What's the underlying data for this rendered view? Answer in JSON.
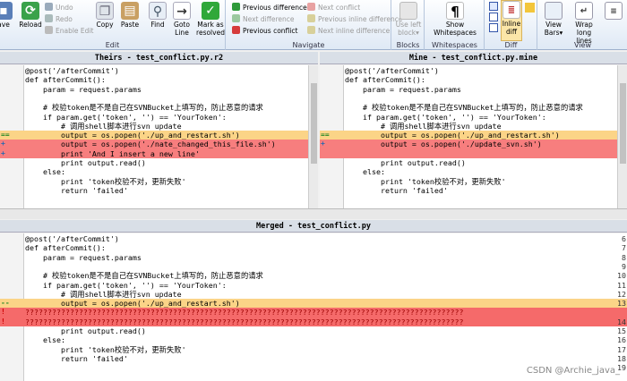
{
  "ribbon": {
    "edit": {
      "caption": "Edit",
      "save": "ave",
      "reload": "Reload",
      "undo": "Undo",
      "redo": "Redo",
      "enable_edit": "Enable Edit",
      "copy": "Copy",
      "paste": "Paste",
      "find": "Find",
      "goto": "Goto",
      "goto2": "Line",
      "mark": "Mark as",
      "mark2": "resolved"
    },
    "navigate": {
      "caption": "Navigate",
      "prev_diff": "Previous difference",
      "next_diff": "Next difference",
      "prev_conflict": "Previous conflict",
      "next_conflict": "Next conflict",
      "prev_inline": "Previous inline difference",
      "next_inline": "Next inline difference"
    },
    "blocks": {
      "caption": "Blocks",
      "use_left": "Use left",
      "use_left2": "block"
    },
    "whitespaces": {
      "caption": "Whitespaces",
      "show": "Show",
      "show2": "Whitespaces"
    },
    "diff": {
      "caption": "Diff",
      "inline": "Inline",
      "inline2": "diff"
    },
    "view": {
      "caption": "View",
      "bars": "View",
      "bars2": "Bars",
      "wrap": "Wrap",
      "wrap2": "long lines"
    }
  },
  "theirs": {
    "title": "Theirs - test_conflict.py.r2",
    "lines": [
      {
        "n": "6",
        "t": "@post('/afterCommit')"
      },
      {
        "n": "7",
        "t": "def afterCommit():"
      },
      {
        "n": "8",
        "t": "    param = request.params"
      },
      {
        "n": "9",
        "t": ""
      },
      {
        "n": "10",
        "t": "    # 校验token是不是自己在SVNBucket上填写的，防止恶意的请求"
      },
      {
        "n": "11",
        "t": "    if param.get('token', '') == 'YourToken':"
      },
      {
        "n": "12",
        "t": "        # 调用shell脚本进行svn update"
      },
      {
        "n": "13",
        "t": "        output = os.popen('./up_and_restart.sh')",
        "m": "==",
        "c": "y"
      },
      {
        "n": "",
        "t": "        output = os.popen('./nate_changed_this_file.sh')",
        "m": "+",
        "c": "r"
      },
      {
        "n": "14",
        "t": "        print 'And I insert a new line'",
        "m": "+",
        "c": "r"
      },
      {
        "n": "15",
        "t": "        print output.read()"
      },
      {
        "n": "16",
        "t": "    else:"
      },
      {
        "n": "17",
        "t": "        print 'token校验不对，更新失败'"
      },
      {
        "n": "18",
        "t": "        return 'failed'"
      },
      {
        "n": "19",
        "t": ""
      }
    ]
  },
  "mine": {
    "title": "Mine - test_conflict.py.mine",
    "lines": [
      {
        "n": "6",
        "t": "@post('/afterCommit')"
      },
      {
        "n": "7",
        "t": "def afterCommit():"
      },
      {
        "n": "8",
        "t": "    param = request.params"
      },
      {
        "n": "9",
        "t": ""
      },
      {
        "n": "10",
        "t": "    # 校验token是不是自己在SVNBucket上填写的，防止恶意的请求"
      },
      {
        "n": "11",
        "t": "    if param.get('token', '') == 'YourToken':"
      },
      {
        "n": "12",
        "t": "        # 调用shell脚本进行svn update"
      },
      {
        "n": "",
        "t": "        output = os.popen('./up_and_restart.sh')",
        "m": "==",
        "c": "y"
      },
      {
        "n": "13",
        "t": "        output = os.popen('./update_svn.sh')",
        "m": "+",
        "c": "r"
      },
      {
        "n": "",
        "t": "",
        "c": "r"
      },
      {
        "n": "14",
        "t": "        print output.read()"
      },
      {
        "n": "15",
        "t": "    else:"
      },
      {
        "n": "16",
        "t": "        print 'token校验不对，更新失败'"
      },
      {
        "n": "17",
        "t": "        return 'failed'"
      },
      {
        "n": "18",
        "t": ""
      }
    ]
  },
  "merged": {
    "title": "Merged - test_conflict.py",
    "lines": [
      {
        "n": "6",
        "t": "@post('/afterCommit')"
      },
      {
        "n": "7",
        "t": "def afterCommit():"
      },
      {
        "n": "8",
        "t": "    param = request.params"
      },
      {
        "n": "9",
        "t": ""
      },
      {
        "n": "10",
        "t": "    # 校验token是不是自己在SVNBucket上填写的，防止恶意的请求"
      },
      {
        "n": "11",
        "t": "    if param.get('token', '') == 'YourToken':"
      },
      {
        "n": "12",
        "t": "        # 调用shell脚本进行svn update"
      },
      {
        "n": "13",
        "t": "        output = os.popen('./up_and_restart.sh')",
        "m": "--",
        "c": "y"
      },
      {
        "n": "",
        "t": "??????????????????????????????????????????????????????????????????????????????????????????????????",
        "m": "!",
        "c": "c"
      },
      {
        "n": "14",
        "t": "??????????????????????????????????????????????????????????????????????????????????????????????????",
        "m": "!",
        "c": "c"
      },
      {
        "n": "15",
        "t": "        print output.read()"
      },
      {
        "n": "16",
        "t": "    else:"
      },
      {
        "n": "17",
        "t": "        print 'token校验不对，更新失败'"
      },
      {
        "n": "18",
        "t": "        return 'failed'"
      },
      {
        "n": "19",
        "t": ""
      }
    ]
  },
  "watermark": "CSDN @Archie_java_"
}
